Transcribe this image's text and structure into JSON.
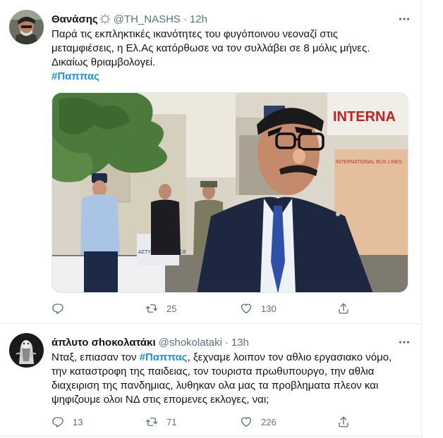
{
  "tweets": [
    {
      "name": "Θανάσης",
      "handle": "@TH_NASHS",
      "time": "12h",
      "text_lines": [
        "Παρά τις εκπληκτικές ικανότητες του φυγόποινου νεοναζί στις",
        "μεταμφιέσεις, η Ελ.Ας κατόρθωσε να τον συλλάβει σε 8 μόλις μήνες.",
        "Δικαίως θριαμβολογεί."
      ],
      "hashtag": "#Παππας",
      "media": {
        "sign_text_1": "INTERNA",
        "sign_text_2": "INTERNATIONAL BUS LINES",
        "car_text": "ΑΣΤΥΝΟΜΙΑ POLICE"
      },
      "replies": "",
      "retweets": "25",
      "likes": "130"
    },
    {
      "name": "άπλυτο σhοκολατάκι",
      "handle": "@shokolataki",
      "time": "13h",
      "text_prefix": "Νταξ, επιασαν τον ",
      "hashtag": "#Παππας",
      "text_first_rest": ", ξεχναμε λοιπον τον αθλιο εργασιακο νόμο,",
      "text_lines": [
        "την καταστροφη της παιδειας, τον τουριστα πρωθυπουργο, την αθλια",
        "διαχειριση της πανδημιας, λυθηκαν ολα μας τα προβληματα πλεον και",
        "ψηφιζουμε ολοι ΝΔ στις επομενες εκλογες, ναι;"
      ],
      "replies": "13",
      "retweets": "71",
      "likes": "226"
    }
  ],
  "separator": "·",
  "colors": {
    "text": "#0f1419",
    "secondary": "#5b7083",
    "link": "#1b95e0",
    "border": "#e6ecf0"
  }
}
